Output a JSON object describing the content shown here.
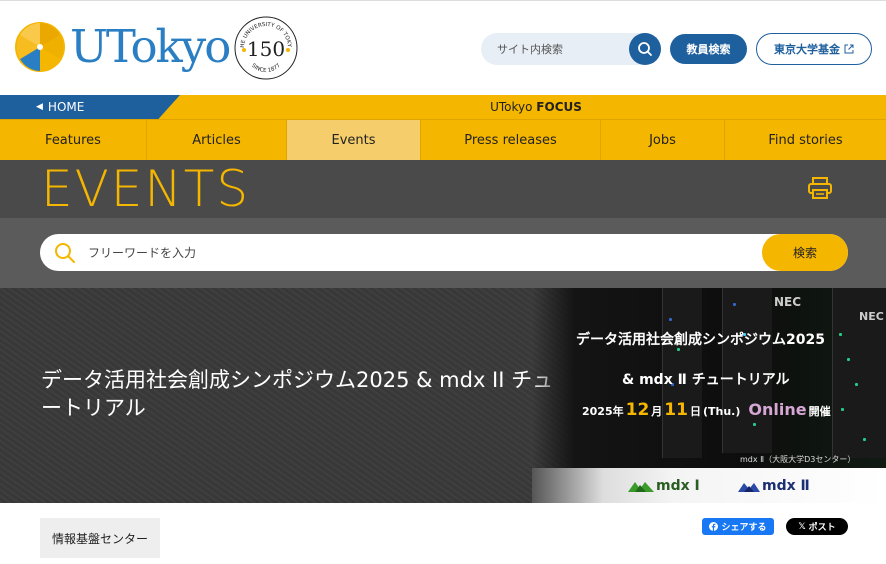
{
  "header": {
    "logo_text": "UTokyo",
    "site_search_placeholder": "サイト内検索",
    "faculty_search_label": "教員検索",
    "fund_label": "東京大学基金",
    "anniversary": {
      "top": "THE UNIVERSITY OF TOKYO",
      "number": "150",
      "bottom": "SINCE 1877"
    }
  },
  "focus_bar": {
    "home_label": "HOME",
    "title_prefix": "UTokyo ",
    "title_bold": "FOCUS"
  },
  "nav": {
    "items": [
      {
        "label": "Features"
      },
      {
        "label": "Articles"
      },
      {
        "label": "Events"
      },
      {
        "label": "Press releases"
      },
      {
        "label": "Jobs"
      },
      {
        "label": "Find stories"
      }
    ],
    "active": "Events"
  },
  "events": {
    "title": "EVENTS",
    "search_placeholder": "フリーワードを入力",
    "search_button": "検索"
  },
  "hero": {
    "title": "データ活用社会創成シンポジウム2025 & mdx II チュートリアル",
    "banner": {
      "line1": "データ活用社会創成シンポジウム2025",
      "line2": "& mdx Ⅱ チュートリアル",
      "date_year": "2025年",
      "date_month": "12",
      "month_unit": "月",
      "date_day": "11",
      "day_unit": "日",
      "weekday": "(Thu.)",
      "online": "Online",
      "online_suffix": "開催",
      "vendor1": "NEC",
      "vendor2": "NEC",
      "caption": "mdx Ⅱ（大阪大学D3センター）",
      "logo1": "mdx Ⅰ",
      "logo2": "mdx Ⅱ"
    }
  },
  "footer": {
    "tag": "情報基盤センター",
    "facebook_share": "シェアする",
    "x_post": "ポスト"
  },
  "colors": {
    "accent_yellow": "#f5b600",
    "brand_blue": "#1e5f9e",
    "dark_band": "#4a4a4a"
  }
}
